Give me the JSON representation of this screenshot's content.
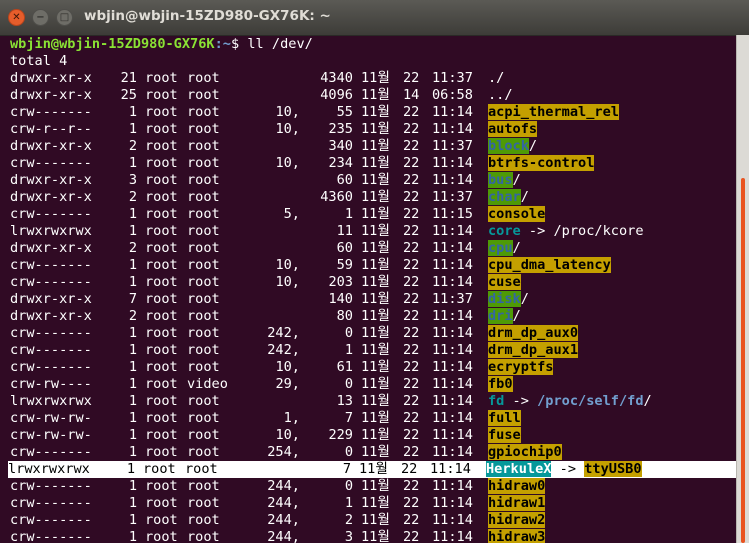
{
  "window": {
    "title": "wbjin@wbjin-15ZD980-GX76K: ~",
    "close_glyph": "✕",
    "min_glyph": "−",
    "max_glyph": "□"
  },
  "prompt": {
    "user": "wbjin@wbjin-15ZD980-GX76K",
    "path": ":~",
    "rest": "$ ll /dev/"
  },
  "total_line": "total 4",
  "rows": [
    {
      "perm": "drwxr-xr-x",
      "links": "21",
      "owner": "root",
      "group": "root",
      "major": "",
      "size": "4340",
      "mon": "11월",
      "day": "22",
      "time": "11:37",
      "name": "./",
      "style": "plain"
    },
    {
      "perm": "drwxr-xr-x",
      "links": "25",
      "owner": "root",
      "group": "root",
      "major": "",
      "size": "4096",
      "mon": "11월",
      "day": "14",
      "time": "06:58",
      "name": "../",
      "style": "plain"
    },
    {
      "perm": "crw-------",
      "links": "1",
      "owner": "root",
      "group": "root",
      "major": "10,",
      "size": "55",
      "mon": "11월",
      "day": "22",
      "time": "11:14",
      "name": "acpi_thermal_rel",
      "style": "cdev"
    },
    {
      "perm": "crw-r--r--",
      "links": "1",
      "owner": "root",
      "group": "root",
      "major": "10,",
      "size": "235",
      "mon": "11월",
      "day": "22",
      "time": "11:14",
      "name": "autofs",
      "style": "cdev"
    },
    {
      "perm": "drwxr-xr-x",
      "links": "2",
      "owner": "root",
      "group": "root",
      "major": "",
      "size": "340",
      "mon": "11월",
      "day": "22",
      "time": "11:37",
      "name": "block",
      "suffix": "/",
      "style": "dir"
    },
    {
      "perm": "crw-------",
      "links": "1",
      "owner": "root",
      "group": "root",
      "major": "10,",
      "size": "234",
      "mon": "11월",
      "day": "22",
      "time": "11:14",
      "name": "btrfs-control",
      "style": "cdev"
    },
    {
      "perm": "drwxr-xr-x",
      "links": "3",
      "owner": "root",
      "group": "root",
      "major": "",
      "size": "60",
      "mon": "11월",
      "day": "22",
      "time": "11:14",
      "name": "bus",
      "suffix": "/",
      "style": "dir"
    },
    {
      "perm": "drwxr-xr-x",
      "links": "2",
      "owner": "root",
      "group": "root",
      "major": "",
      "size": "4360",
      "mon": "11월",
      "day": "22",
      "time": "11:37",
      "name": "char",
      "suffix": "/",
      "style": "dir"
    },
    {
      "perm": "crw-------",
      "links": "1",
      "owner": "root",
      "group": "root",
      "major": "5,",
      "size": "1",
      "mon": "11월",
      "day": "22",
      "time": "11:15",
      "name": "console",
      "style": "cdev"
    },
    {
      "perm": "lrwxrwxrwx",
      "links": "1",
      "owner": "root",
      "group": "root",
      "major": "",
      "size": "11",
      "mon": "11월",
      "day": "22",
      "time": "11:14",
      "name": "core",
      "arrow": " -> ",
      "target": "/proc/kcore",
      "style": "link"
    },
    {
      "perm": "drwxr-xr-x",
      "links": "2",
      "owner": "root",
      "group": "root",
      "major": "",
      "size": "60",
      "mon": "11월",
      "day": "22",
      "time": "11:14",
      "name": "cpu",
      "suffix": "/",
      "style": "dir"
    },
    {
      "perm": "crw-------",
      "links": "1",
      "owner": "root",
      "group": "root",
      "major": "10,",
      "size": "59",
      "mon": "11월",
      "day": "22",
      "time": "11:14",
      "name": "cpu_dma_latency",
      "style": "cdev"
    },
    {
      "perm": "crw-------",
      "links": "1",
      "owner": "root",
      "group": "root",
      "major": "10,",
      "size": "203",
      "mon": "11월",
      "day": "22",
      "time": "11:14",
      "name": "cuse",
      "style": "cdev"
    },
    {
      "perm": "drwxr-xr-x",
      "links": "7",
      "owner": "root",
      "group": "root",
      "major": "",
      "size": "140",
      "mon": "11월",
      "day": "22",
      "time": "11:37",
      "name": "disk",
      "suffix": "/",
      "style": "dir"
    },
    {
      "perm": "drwxr-xr-x",
      "links": "2",
      "owner": "root",
      "group": "root",
      "major": "",
      "size": "80",
      "mon": "11월",
      "day": "22",
      "time": "11:14",
      "name": "dri",
      "suffix": "/",
      "style": "dir"
    },
    {
      "perm": "crw-------",
      "links": "1",
      "owner": "root",
      "group": "root",
      "major": "242,",
      "size": "0",
      "mon": "11월",
      "day": "22",
      "time": "11:14",
      "name": "drm_dp_aux0",
      "style": "cdev"
    },
    {
      "perm": "crw-------",
      "links": "1",
      "owner": "root",
      "group": "root",
      "major": "242,",
      "size": "1",
      "mon": "11월",
      "day": "22",
      "time": "11:14",
      "name": "drm_dp_aux1",
      "style": "cdev"
    },
    {
      "perm": "crw-------",
      "links": "1",
      "owner": "root",
      "group": "root",
      "major": "10,",
      "size": "61",
      "mon": "11월",
      "day": "22",
      "time": "11:14",
      "name": "ecryptfs",
      "style": "cdev"
    },
    {
      "perm": "crw-rw----",
      "links": "1",
      "owner": "root",
      "group": "video",
      "major": "29,",
      "size": "0",
      "mon": "11월",
      "day": "22",
      "time": "11:14",
      "name": "fb0",
      "style": "cdev"
    },
    {
      "perm": "lrwxrwxrwx",
      "links": "1",
      "owner": "root",
      "group": "root",
      "major": "",
      "size": "13",
      "mon": "11월",
      "day": "22",
      "time": "11:14",
      "name": "fd",
      "arrow": " -> ",
      "target": "/proc/self/fd",
      "target_suffix": "/",
      "style": "link-dir"
    },
    {
      "perm": "crw-rw-rw-",
      "links": "1",
      "owner": "root",
      "group": "root",
      "major": "1,",
      "size": "7",
      "mon": "11월",
      "day": "22",
      "time": "11:14",
      "name": "full",
      "style": "cdev"
    },
    {
      "perm": "crw-rw-rw-",
      "links": "1",
      "owner": "root",
      "group": "root",
      "major": "10,",
      "size": "229",
      "mon": "11월",
      "day": "22",
      "time": "11:14",
      "name": "fuse",
      "style": "cdev"
    },
    {
      "perm": "crw-------",
      "links": "1",
      "owner": "root",
      "group": "root",
      "major": "254,",
      "size": "0",
      "mon": "11월",
      "day": "22",
      "time": "11:14",
      "name": "gpiochip0",
      "style": "cdev"
    },
    {
      "perm": "lrwxrwxrwx",
      "links": "1",
      "owner": "root",
      "group": "root",
      "major": "",
      "size": "7",
      "mon": "11월",
      "day": "22",
      "time": "11:14",
      "name": "HerkuleX",
      "arrow": " -> ",
      "target": "ttyUSB0",
      "style": "selected"
    },
    {
      "perm": "crw-------",
      "links": "1",
      "owner": "root",
      "group": "root",
      "major": "244,",
      "size": "0",
      "mon": "11월",
      "day": "22",
      "time": "11:14",
      "name": "hidraw0",
      "style": "cdev"
    },
    {
      "perm": "crw-------",
      "links": "1",
      "owner": "root",
      "group": "root",
      "major": "244,",
      "size": "1",
      "mon": "11월",
      "day": "22",
      "time": "11:14",
      "name": "hidraw1",
      "style": "cdev"
    },
    {
      "perm": "crw-------",
      "links": "1",
      "owner": "root",
      "group": "root",
      "major": "244,",
      "size": "2",
      "mon": "11월",
      "day": "22",
      "time": "11:14",
      "name": "hidraw2",
      "style": "cdev"
    },
    {
      "perm": "crw-------",
      "links": "1",
      "owner": "root",
      "group": "root",
      "major": "244,",
      "size": "3",
      "mon": "11월",
      "day": "22",
      "time": "11:14",
      "name": "hidraw3",
      "style": "cdev"
    }
  ]
}
